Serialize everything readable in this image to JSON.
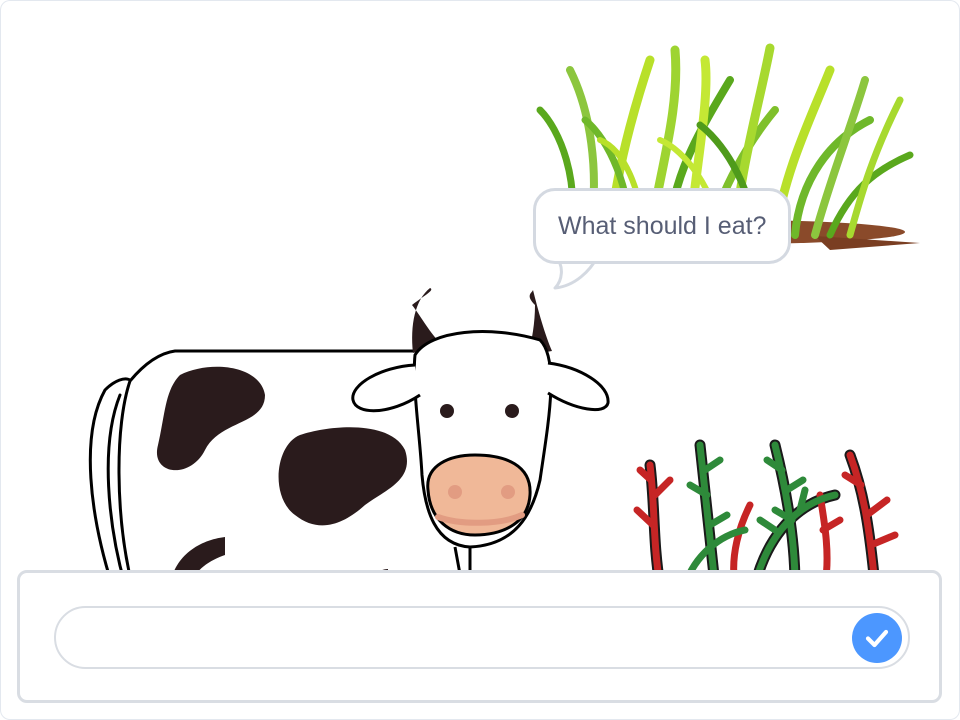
{
  "stage": {
    "speech_bubble": {
      "text": "What should I eat?"
    },
    "sprites": [
      {
        "name": "grass",
        "icon": "grass-illustration"
      },
      {
        "name": "cow",
        "icon": "cow-illustration"
      },
      {
        "name": "bush",
        "icon": "red-green-plant-illustration"
      }
    ]
  },
  "ask_prompt": {
    "answer_value": "",
    "answer_placeholder": "",
    "submit_icon": "check-icon"
  },
  "colors": {
    "bubble_text": "#575e75",
    "bubble_border": "#d4d9e1",
    "submit_button": "#4c97ff",
    "cow_spots": "#2a1b1c",
    "cow_nose": "#f0b898",
    "grass_light": "#b8e02a",
    "grass_dark": "#5aa81d",
    "soil": "#8a4a2a",
    "plant_red": "#c62525",
    "plant_green": "#2e8a3a"
  }
}
